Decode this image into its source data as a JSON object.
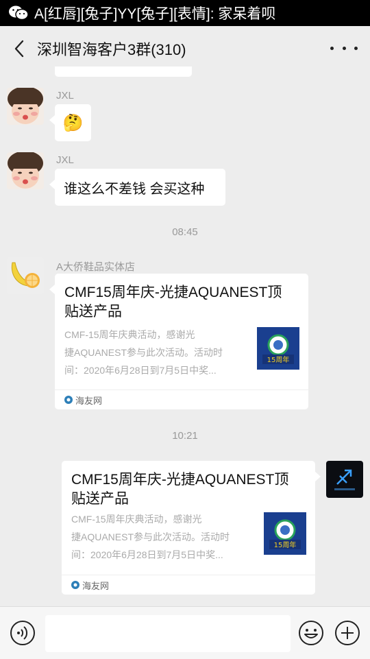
{
  "notification": {
    "text": "A[红唇][兔子]YY[兔子][表情]: 家呆着呗"
  },
  "header": {
    "title": "深圳智海客户3群(310)"
  },
  "messages": [
    {
      "sender": "JXL",
      "content": "🤔"
    },
    {
      "sender": "JXL",
      "content": "谁这么不差钱 会买这种"
    }
  ],
  "timestamps": [
    "08:45",
    "10:21"
  ],
  "card1": {
    "sender": "A大侨鞋品实体店",
    "title": "CMF15周年庆-光捷AQUANEST顶贴送产品",
    "desc_lines": [
      "CMF-15周年庆典活动，感谢光",
      "捷AQUANEST参与此次活动。活动时",
      "间：2020年6月28日到7月5日中奖..."
    ],
    "source": "海友网",
    "thumb_label": "15周年"
  },
  "card2": {
    "title": "CMF15周年庆-光捷AQUANEST顶贴送产品",
    "desc_lines": [
      "CMF-15周年庆典活动，感谢光",
      "捷AQUANEST参与此次活动。活动时",
      "间：2020年6月28日到7月5日中奖..."
    ],
    "source": "海友网",
    "thumb_label": "15周年"
  },
  "input": {
    "placeholder": ""
  },
  "colors": {
    "background": "#ededed",
    "bubble": "#ffffff",
    "accent_thumb": "#1a3f8f"
  }
}
